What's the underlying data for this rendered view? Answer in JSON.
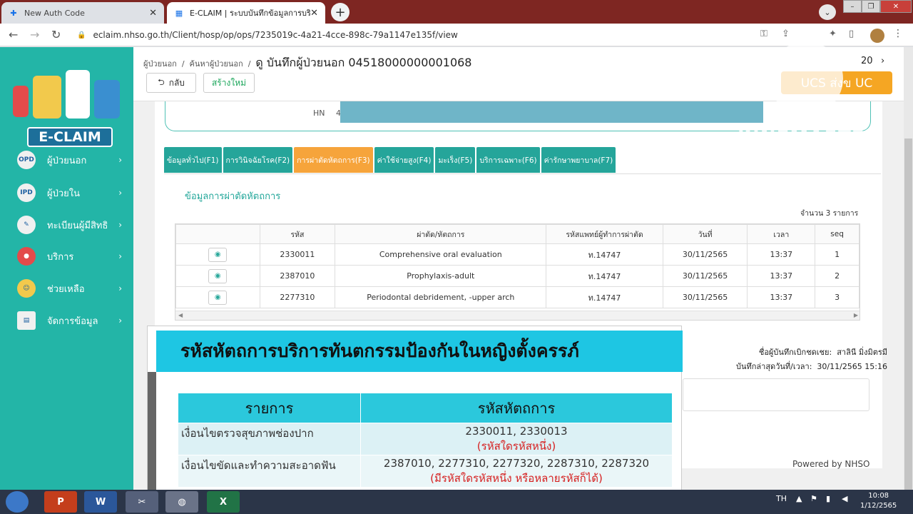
{
  "browser": {
    "tabs": [
      {
        "title": "New Auth Code"
      },
      {
        "title": "E-CLAIM | ระบบบันทึกข้อมูลการบริก"
      }
    ],
    "url": "eclaim.nhso.go.th/Client/hosp/op/ops/7235019c-4a21-4cce-898c-79a1147e135f/view"
  },
  "sidebar": {
    "logo_text": "E-CLAIM",
    "items": [
      {
        "label": "ผู้ป่วยนอก",
        "icon": "opd-icon",
        "icon_text": "OPD"
      },
      {
        "label": "ผู้ป่วยใน",
        "icon": "ipd-icon",
        "icon_text": "IPD"
      },
      {
        "label": "ทะเบียนผู้มีสิทธิ",
        "icon": "registry-icon",
        "icon_text": ""
      },
      {
        "label": "บริการ",
        "icon": "location-pin-icon",
        "icon_text": ""
      },
      {
        "label": "ช่วยเหลือ",
        "icon": "support-icon",
        "icon_text": ""
      },
      {
        "label": "จัดการข้อมูล",
        "icon": "data-manage-icon",
        "icon_text": ""
      }
    ]
  },
  "header": {
    "breadcrumb_1": "ผู้ป่วยนอก",
    "breadcrumb_2": "ค้นหาผู้ป่วยนอก",
    "title": "ดู บันทึกผู้ป่วยนอก 04518000000001068",
    "back_label": "กลับ",
    "new_label": "สร้างใหม่",
    "pager_value": "20",
    "ucs_label": "UCS ส่งข UC"
  },
  "patient": {
    "hn_label": "HN",
    "hn_value": "4"
  },
  "form_tabs": [
    {
      "label": "ข้อมูลทั่วไป(F1)",
      "active": false
    },
    {
      "label": "การวินิจฉัยโรค(F2)",
      "active": false
    },
    {
      "label": "การผ่าตัดหัตถการ(F3)",
      "active": true
    },
    {
      "label": "ค่าใช้จ่ายสูง(F4)",
      "active": false
    },
    {
      "label": "มะเร็ง(F5)",
      "active": false
    },
    {
      "label": "บริการเฉพาะ(F6)",
      "active": false
    },
    {
      "label": "ค่ารักษาพยาบาล(F7)",
      "active": false
    }
  ],
  "procedures": {
    "section_title": "ข้อมูลการผ่าตัดหัตถการ",
    "count_text": "จำนวน 3 รายการ",
    "columns": [
      "",
      "รหัส",
      "ผ่าตัด/หัตถการ",
      "รหัสแพทย์ผู้ทำการผ่าตัด",
      "วันที่",
      "เวลา",
      "seq"
    ],
    "rows": [
      {
        "code": "2330011",
        "name": "Comprehensive oral evaluation",
        "doctor": "ท.14747",
        "date": "30/11/2565",
        "time": "13:37",
        "seq": "1"
      },
      {
        "code": "2387010",
        "name": "Prophylaxis-adult",
        "doctor": "ท.14747",
        "date": "30/11/2565",
        "time": "13:37",
        "seq": "2"
      },
      {
        "code": "2277310",
        "name": "Periodontal debridement, -upper arch",
        "doctor": "ท.14747",
        "date": "30/11/2565",
        "time": "13:37",
        "seq": "3"
      }
    ]
  },
  "recorder": {
    "name_label": "ชื่อผู้บันทึกเบิกชดเชย:",
    "name_value": "สาลินี มิ่งมิตรมี",
    "updated_label": "บันทึกล่าสุดวันที่/เวลา:",
    "updated_value": "30/11/2565 15:16"
  },
  "footer": {
    "powered": "Powered by NHSO"
  },
  "overlay": {
    "title": "รหัสหัตถการบริการทันตกรรมป้องกันในหญิงตั้งครรภ์",
    "col_item": "รายการ",
    "col_code": "รหัสหัตถการ",
    "rows": [
      {
        "item": "เงื่อนไขตรวจสุขภาพช่องปาก",
        "codes": "2330011, 2330013",
        "note": "(รหัสใดรหัสหนึ่ง)"
      },
      {
        "item": "เงื่อนไขขัดและทำความสะอาดฟัน",
        "codes": "2387010, 2277310, 2277320, 2287310, 2287320",
        "note": "(มีรหัสใดรหัสหนึ่ง หรือหลายรหัสก็ได้)"
      }
    ]
  },
  "watermark": "KINEMASTER",
  "taskbar": {
    "lang": "TH",
    "time": "10:08",
    "date": "1/12/2565"
  },
  "colors": {
    "teal": "#23b5a7",
    "orange": "#f6a43b",
    "overlay_cyan": "#1ec6e3"
  }
}
